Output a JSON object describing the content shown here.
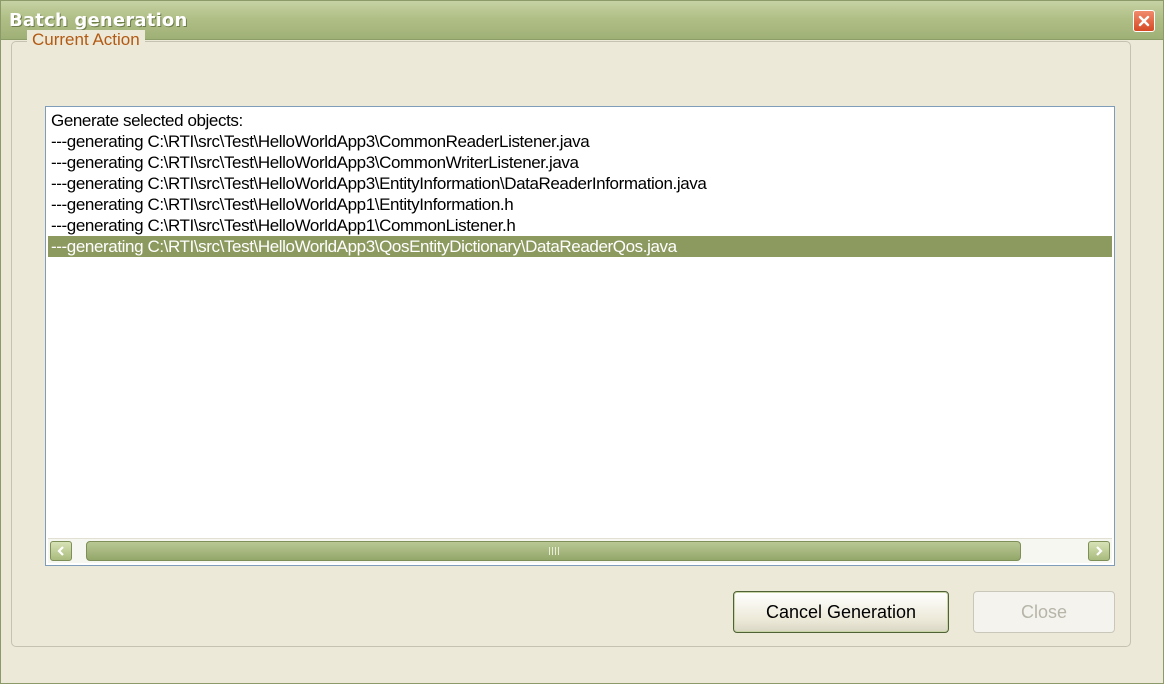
{
  "window": {
    "title": "Batch generation",
    "close_icon": "close-icon"
  },
  "group": {
    "legend": "Current Action"
  },
  "log": {
    "lines": [
      "Generate selected objects:",
      "---generating C:\\RTI\\src\\Test\\HelloWorldApp3\\CommonReaderListener.java",
      "---generating C:\\RTI\\src\\Test\\HelloWorldApp3\\CommonWriterListener.java",
      "---generating C:\\RTI\\src\\Test\\HelloWorldApp3\\EntityInformation\\DataReaderInformation.java",
      "---generating C:\\RTI\\src\\Test\\HelloWorldApp1\\EntityInformation.h",
      "---generating C:\\RTI\\src\\Test\\HelloWorldApp1\\CommonListener.h",
      "---generating C:\\RTI\\src\\Test\\HelloWorldApp3\\QosEntityDictionary\\DataReaderQos.java"
    ],
    "selected_index": 6
  },
  "scrollbar": {
    "left_icon": "chevron-left-icon",
    "right_icon": "chevron-right-icon"
  },
  "buttons": {
    "cancel_label": "Cancel Generation",
    "close_label": "Close",
    "close_enabled": false
  },
  "colors": {
    "titlebar": "#b0bf86",
    "selection": "#8c9a5f",
    "legend_text": "#b25a13",
    "close_button": "#d64a25"
  }
}
